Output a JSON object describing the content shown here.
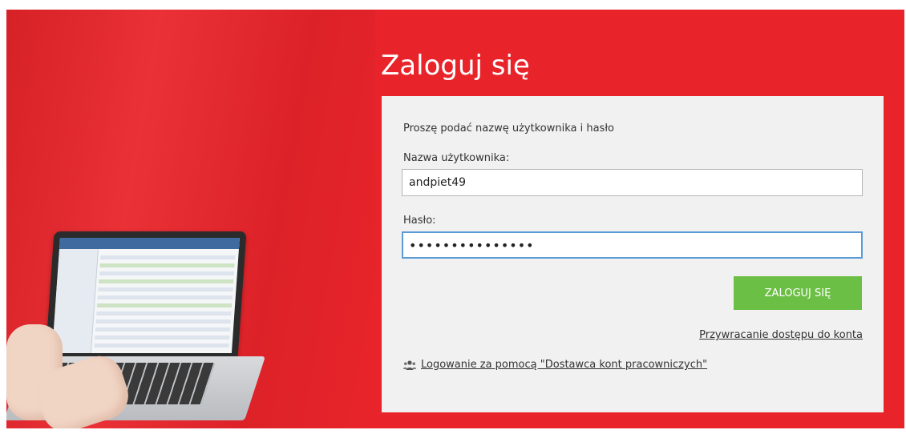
{
  "login": {
    "title": "Zaloguj się",
    "instruction": "Proszę podać nazwę użytkownika i hasło",
    "username_label": "Nazwa użytkownika:",
    "username_value": "andpiet49",
    "password_label": "Hasło:",
    "password_value": "•••••••••••••••",
    "submit_label": "ZALOGUJ SIĘ",
    "recover_link": "Przywracanie dostępu do konta",
    "provider_link": "Logowanie za pomocą \"Dostawca kont pracowniczych\"",
    "provider_icon": "users-icon"
  },
  "colors": {
    "background_red": "#e8242a",
    "panel": "#f1f1f1",
    "button_green": "#6cbf45",
    "focus_blue": "#5b9bd5"
  }
}
